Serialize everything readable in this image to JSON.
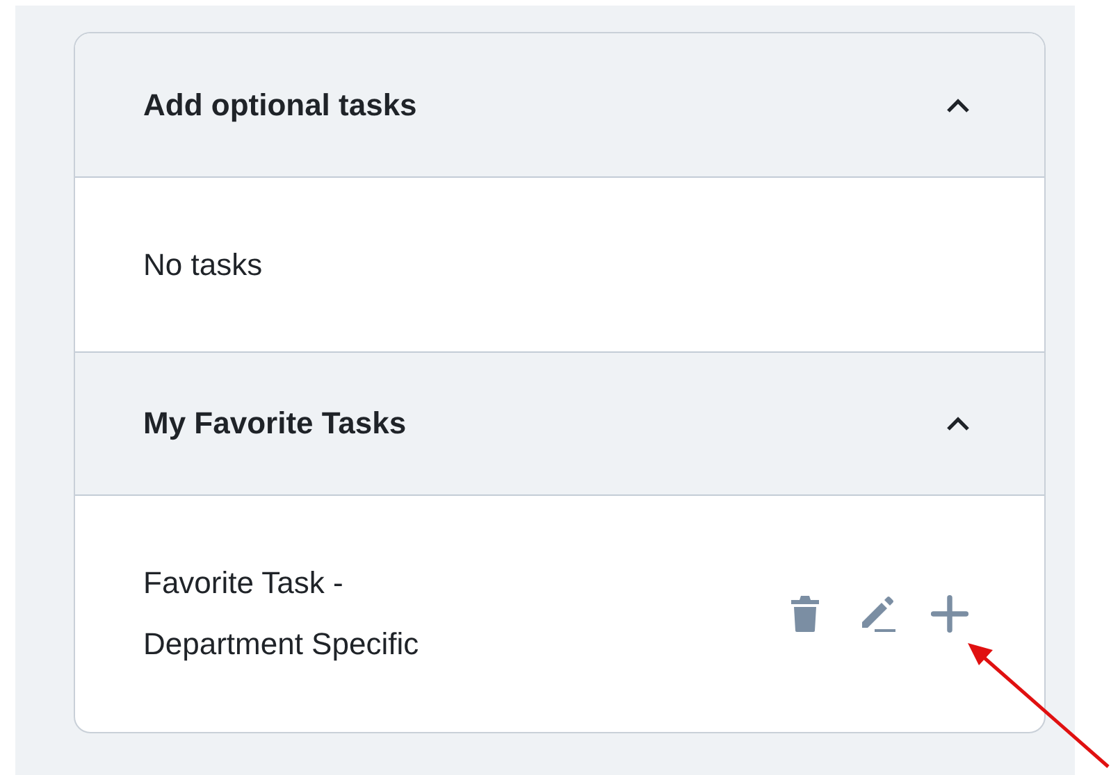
{
  "sections": [
    {
      "title": "Add optional tasks",
      "expanded": true,
      "empty_text": "No tasks"
    },
    {
      "title": "My Favorite Tasks",
      "expanded": true,
      "tasks": [
        {
          "name": "Favorite Task - Department Specific"
        }
      ]
    }
  ]
}
